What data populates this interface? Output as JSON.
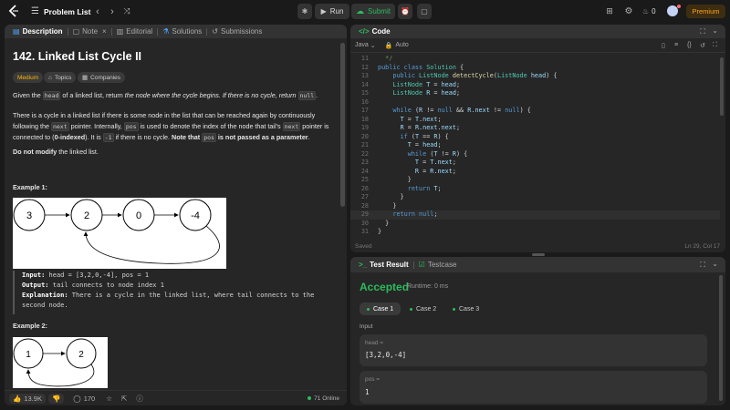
{
  "topbar": {
    "logo": "leetcode-logo",
    "problem_list": "Problem List",
    "run": "Run",
    "submit": "Submit",
    "fire_count": "0",
    "premium": "Premium"
  },
  "left": {
    "tabs": [
      {
        "label": "Description"
      },
      {
        "label": "Note"
      },
      {
        "label": "Editorial"
      },
      {
        "label": "Solutions"
      },
      {
        "label": "Submissions"
      }
    ],
    "title": "142. Linked List Cycle II",
    "badges": {
      "difficulty": "Medium",
      "topics": "Topics",
      "companies": "Companies"
    },
    "p1": {
      "a": "Given the ",
      "b": "head",
      "c": " of a linked list, return ",
      "d": "the node where the cycle begins. If there is no cycle, return ",
      "e": "null",
      "f": "."
    },
    "p2": {
      "a": "There is a cycle in a linked list if there is some node in the list that can be reached again by continuously following the ",
      "b": "next",
      "c": " pointer. Internally, ",
      "d": "pos",
      "e": " is used to denote the index of the node that tail's ",
      "f": "next",
      "g": " pointer is connected to (",
      "h": "0-indexed",
      "i": "). It is ",
      "j": "-1",
      "k": " if there is no cycle. ",
      "l": "Note that ",
      "m": "pos",
      "n": " is not passed as a parameter",
      "o": "."
    },
    "p3": {
      "a": "Do not modify",
      "b": " the linked list."
    },
    "example1": {
      "title": "Example 1:",
      "nodes": [
        "3",
        "2",
        "0",
        "-4"
      ],
      "input_label": "Input:",
      "input": " head = [3,2,0,-4], pos = 1",
      "output_label": "Output:",
      "output": " tail connects to node index 1",
      "expl_label": "Explanation:",
      "expl": " There is a cycle in the linked list, where tail connects to the second node."
    },
    "example2": {
      "title": "Example 2:",
      "nodes": [
        "1",
        "2"
      ]
    },
    "footer": {
      "likes": "13.9K",
      "comments": "170",
      "online": "71 Online"
    }
  },
  "code": {
    "tab": "Code",
    "language": "Java",
    "mode": "Auto",
    "status": "Saved",
    "cursor": "Ln 29, Col 17",
    "lines": [
      {
        "n": "11",
        "t": [
          [
            "cm",
            "  */"
          ]
        ]
      },
      {
        "n": "12",
        "t": [
          [
            "kw",
            "public class "
          ],
          [
            "ty",
            "Solution"
          ],
          [
            "pl",
            " {"
          ]
        ]
      },
      {
        "n": "13",
        "t": [
          [
            "pl",
            "    "
          ],
          [
            "kw",
            "public "
          ],
          [
            "ty",
            "ListNode "
          ],
          [
            "fn",
            "detectCycle"
          ],
          [
            "pl",
            "("
          ],
          [
            "ty",
            "ListNode "
          ],
          [
            "vr",
            "head"
          ],
          [
            "pl",
            ") {"
          ]
        ]
      },
      {
        "n": "14",
        "t": [
          [
            "pl",
            "    "
          ],
          [
            "ty",
            "ListNode "
          ],
          [
            "vr",
            "T"
          ],
          [
            "pl",
            " = "
          ],
          [
            "vr",
            "head"
          ],
          [
            "pl",
            ";"
          ]
        ]
      },
      {
        "n": "15",
        "t": [
          [
            "pl",
            "    "
          ],
          [
            "ty",
            "ListNode "
          ],
          [
            "vr",
            "R"
          ],
          [
            "pl",
            " = "
          ],
          [
            "vr",
            "head"
          ],
          [
            "pl",
            ";"
          ]
        ]
      },
      {
        "n": "16",
        "t": [
          [
            "pl",
            ""
          ]
        ]
      },
      {
        "n": "17",
        "t": [
          [
            "pl",
            "    "
          ],
          [
            "kw",
            "while "
          ],
          [
            "pl",
            "("
          ],
          [
            "vr",
            "R"
          ],
          [
            "pl",
            " != "
          ],
          [
            "kw",
            "null"
          ],
          [
            "pl",
            " && "
          ],
          [
            "vr",
            "R"
          ],
          [
            "pl",
            "."
          ],
          [
            "vr",
            "next"
          ],
          [
            "pl",
            " != "
          ],
          [
            "kw",
            "null"
          ],
          [
            "pl",
            ") {"
          ]
        ]
      },
      {
        "n": "18",
        "t": [
          [
            "pl",
            "      "
          ],
          [
            "vr",
            "T"
          ],
          [
            "pl",
            " = "
          ],
          [
            "vr",
            "T"
          ],
          [
            "pl",
            "."
          ],
          [
            "vr",
            "next"
          ],
          [
            "pl",
            ";"
          ]
        ]
      },
      {
        "n": "19",
        "t": [
          [
            "pl",
            "      "
          ],
          [
            "vr",
            "R"
          ],
          [
            "pl",
            " = "
          ],
          [
            "vr",
            "R"
          ],
          [
            "pl",
            "."
          ],
          [
            "vr",
            "next"
          ],
          [
            "pl",
            "."
          ],
          [
            "vr",
            "next"
          ],
          [
            "pl",
            ";"
          ]
        ]
      },
      {
        "n": "20",
        "t": [
          [
            "pl",
            "      "
          ],
          [
            "kw",
            "if "
          ],
          [
            "pl",
            "("
          ],
          [
            "vr",
            "T"
          ],
          [
            "pl",
            " == "
          ],
          [
            "vr",
            "R"
          ],
          [
            "pl",
            ") {"
          ]
        ]
      },
      {
        "n": "21",
        "t": [
          [
            "pl",
            "        "
          ],
          [
            "vr",
            "T"
          ],
          [
            "pl",
            " = "
          ],
          [
            "vr",
            "head"
          ],
          [
            "pl",
            ";"
          ]
        ]
      },
      {
        "n": "22",
        "t": [
          [
            "pl",
            "        "
          ],
          [
            "kw",
            "while "
          ],
          [
            "pl",
            "("
          ],
          [
            "vr",
            "T"
          ],
          [
            "pl",
            " != "
          ],
          [
            "vr",
            "R"
          ],
          [
            "pl",
            ") {"
          ]
        ]
      },
      {
        "n": "23",
        "t": [
          [
            "pl",
            "          "
          ],
          [
            "vr",
            "T"
          ],
          [
            "pl",
            " = "
          ],
          [
            "vr",
            "T"
          ],
          [
            "pl",
            "."
          ],
          [
            "vr",
            "next"
          ],
          [
            "pl",
            ";"
          ]
        ]
      },
      {
        "n": "24",
        "t": [
          [
            "pl",
            "          "
          ],
          [
            "vr",
            "R"
          ],
          [
            "pl",
            " = "
          ],
          [
            "vr",
            "R"
          ],
          [
            "pl",
            "."
          ],
          [
            "vr",
            "next"
          ],
          [
            "pl",
            ";"
          ]
        ]
      },
      {
        "n": "25",
        "t": [
          [
            "pl",
            "        }"
          ]
        ]
      },
      {
        "n": "26",
        "t": [
          [
            "pl",
            "        "
          ],
          [
            "kw",
            "return "
          ],
          [
            "vr",
            "T"
          ],
          [
            "pl",
            ";"
          ]
        ]
      },
      {
        "n": "27",
        "t": [
          [
            "pl",
            "      }"
          ]
        ]
      },
      {
        "n": "28",
        "t": [
          [
            "pl",
            "    }"
          ]
        ]
      },
      {
        "n": "29",
        "t": [
          [
            "pl",
            "    "
          ],
          [
            "kw",
            "return "
          ],
          [
            "kw",
            "null"
          ],
          [
            "pl",
            ";"
          ]
        ]
      },
      {
        "n": "30",
        "t": [
          [
            "pl",
            "  }"
          ]
        ]
      },
      {
        "n": "31",
        "t": [
          [
            "pl",
            "}"
          ]
        ]
      }
    ]
  },
  "result": {
    "tab1": "Test Result",
    "tab2": "Testcase",
    "status": "Accepted",
    "runtime": "Runtime: 0 ms",
    "cases": [
      "Case 1",
      "Case 2",
      "Case 3"
    ],
    "input_label": "Input",
    "head_label": "head =",
    "head_value": "[3,2,0,-4]",
    "pos_label": "pos =",
    "pos_value": "1"
  },
  "colors": {
    "accepted": "#2cbb5d",
    "submit": "#2cbb5d",
    "premium": "#ffa116",
    "medium": "#ffb800"
  }
}
